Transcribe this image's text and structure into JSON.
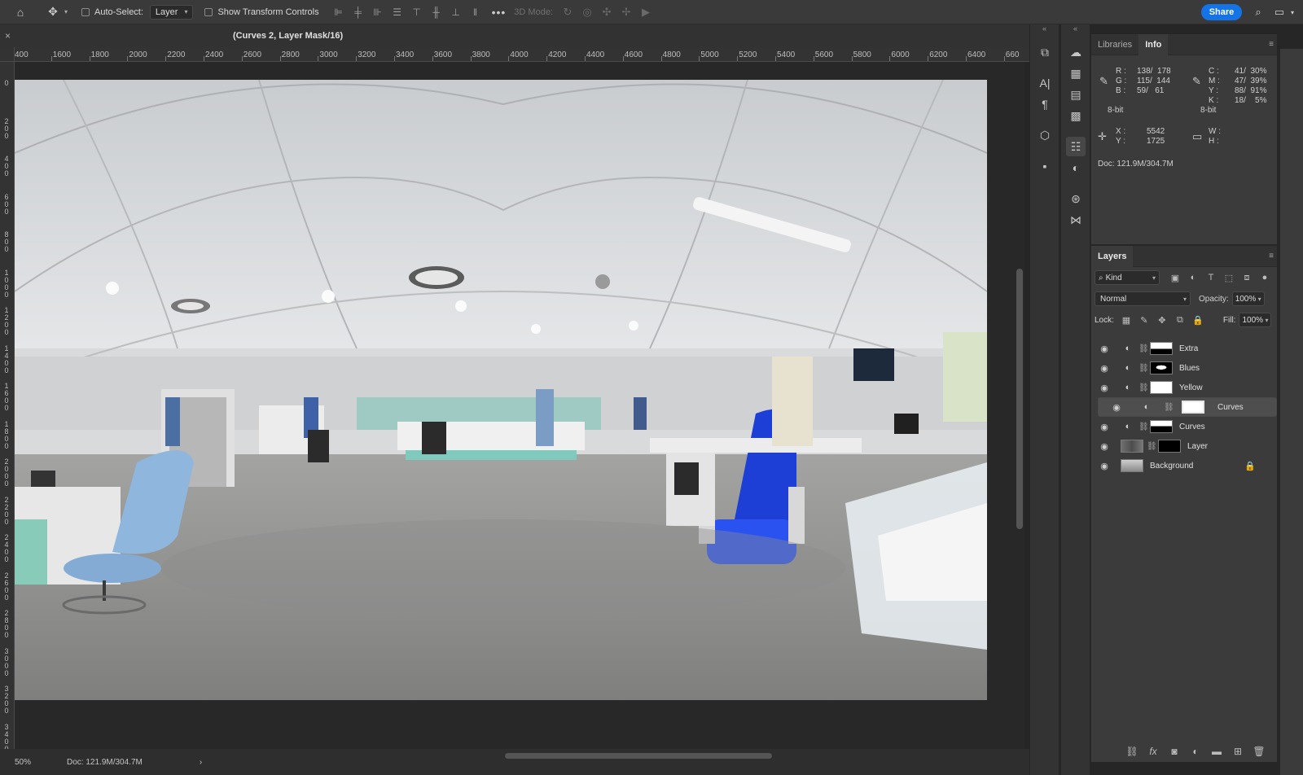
{
  "optbar": {
    "auto_select_label": "Auto-Select:",
    "auto_select_value": "Layer",
    "show_transform_label": "Show Transform Controls",
    "more": "•••",
    "mode3d_label": "3D Mode:",
    "share_label": "Share"
  },
  "document": {
    "tab_title": "(Curves 2, Layer Mask/16)",
    "close": "×"
  },
  "ruler": {
    "h_ticks": [
      "400",
      "1600",
      "1800",
      "2000",
      "2200",
      "2400",
      "2600",
      "2800",
      "3000",
      "3200",
      "3400",
      "3600",
      "3800",
      "4000",
      "4200",
      "4400",
      "4600",
      "4800",
      "5000",
      "5200",
      "5400",
      "5600",
      "5800",
      "6000",
      "6200",
      "6400",
      "660"
    ],
    "v_ticks": [
      "0",
      "200",
      "400",
      "600",
      "800",
      "1000",
      "1200",
      "1400",
      "1600",
      "1800",
      "2000",
      "2200",
      "2400",
      "2600",
      "2800",
      "3000",
      "3200",
      "3400"
    ]
  },
  "status": {
    "zoom": "50%",
    "doc_size": "Doc: 121.9M/304.7M",
    "arrow": "›"
  },
  "info_panel": {
    "tabs": [
      "Libraries",
      "Info"
    ],
    "active_tab": "Info",
    "rgb": {
      "r_label": "R :",
      "r": "138/  178",
      "g_label": "G :",
      "g": "115/  144",
      "b_label": "B :",
      "b": "59/   61"
    },
    "cmyk": {
      "c_label": "C :",
      "c": "41/  30%",
      "m_label": "M :",
      "m": "47/  39%",
      "y_label": "Y :",
      "y": "88/  91%",
      "k_label": "K :",
      "k": "18/    5%"
    },
    "bit_left": "8-bit",
    "bit_right": "8-bit",
    "xy": {
      "x_label": "X :",
      "x": "5542",
      "y_label": "Y :",
      "y": "1725"
    },
    "wh": {
      "w_label": "W :",
      "h_label": "H :"
    },
    "doc": "Doc: 121.9M/304.7M"
  },
  "layers_panel": {
    "title": "Layers",
    "kind_label": "Kind",
    "blend_mode": "Normal",
    "opacity_label": "Opacity:",
    "opacity": "100%",
    "lock_label": "Lock:",
    "fill_label": "Fill:",
    "fill": "100%",
    "layers": [
      {
        "name": "Extra",
        "type": "adjustment",
        "thumb": "white-black",
        "selected": false
      },
      {
        "name": "Blues",
        "type": "adjustment",
        "thumb": "mask-shape",
        "selected": false
      },
      {
        "name": "Yellow",
        "type": "adjustment",
        "thumb": "white",
        "selected": false
      },
      {
        "name": "Curves",
        "type": "adjustment",
        "thumb": "white-framed",
        "selected": true
      },
      {
        "name": "Curves",
        "type": "adjustment",
        "thumb": "white-black",
        "selected": false
      },
      {
        "name": "Layer",
        "type": "pixel",
        "thumb": "black",
        "selected": false
      },
      {
        "name": "Background",
        "type": "background",
        "thumb": "photo",
        "selected": false,
        "locked": true
      }
    ]
  },
  "colors": {
    "accent": "#1473e6",
    "panel_bg": "#3b3b3b",
    "canvas_bg": "#282828"
  }
}
